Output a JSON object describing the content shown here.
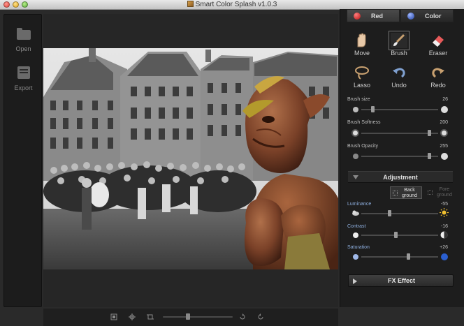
{
  "window": {
    "title": "Smart Color Splash v1.0.3"
  },
  "left_panel": {
    "open_label": "Open",
    "export_label": "Export"
  },
  "tabs": {
    "red_label": "Red",
    "color_label": "Color"
  },
  "tools": {
    "move": "Move",
    "brush": "Brush",
    "eraser": "Eraser",
    "lasso": "Lasso",
    "undo": "Undo",
    "redo": "Redo",
    "selected": "brush"
  },
  "brush": {
    "size_label": "Brush size",
    "size_value": "26",
    "size_level": 0.13,
    "softness_label": "Brush Softness",
    "softness_value": "200",
    "softness_level": 0.9,
    "opacity_label": "Brush Opacity",
    "opacity_value": "255",
    "opacity_level": 0.9
  },
  "adjustment": {
    "title": "Adjustment",
    "back_ground_label_1": "Back",
    "back_ground_label_2": "ground",
    "fore_ground_label_1": "Fore",
    "fore_ground_label_2": "ground",
    "luminance_label": "Luminance",
    "luminance_value": "-55",
    "luminance_level": 0.36,
    "contrast_label": "Contrast",
    "contrast_value": "-16",
    "contrast_level": 0.45,
    "saturation_label": "Saturation",
    "saturation_value": "+26",
    "saturation_level": 0.62
  },
  "fx": {
    "label": "FX Effect"
  },
  "bottom_bar": {
    "zoom_level": 0.35
  },
  "colors": {
    "panel": "#1d1d1d",
    "accent_red": "#b81010",
    "accent_blue": "#2040a0"
  },
  "icons": [
    "folder-icon",
    "export-icon",
    "move-hand-icon",
    "brush-icon",
    "eraser-icon",
    "lasso-icon",
    "undo-icon",
    "redo-icon",
    "sun-icon",
    "contrast-icon",
    "play-icon"
  ]
}
